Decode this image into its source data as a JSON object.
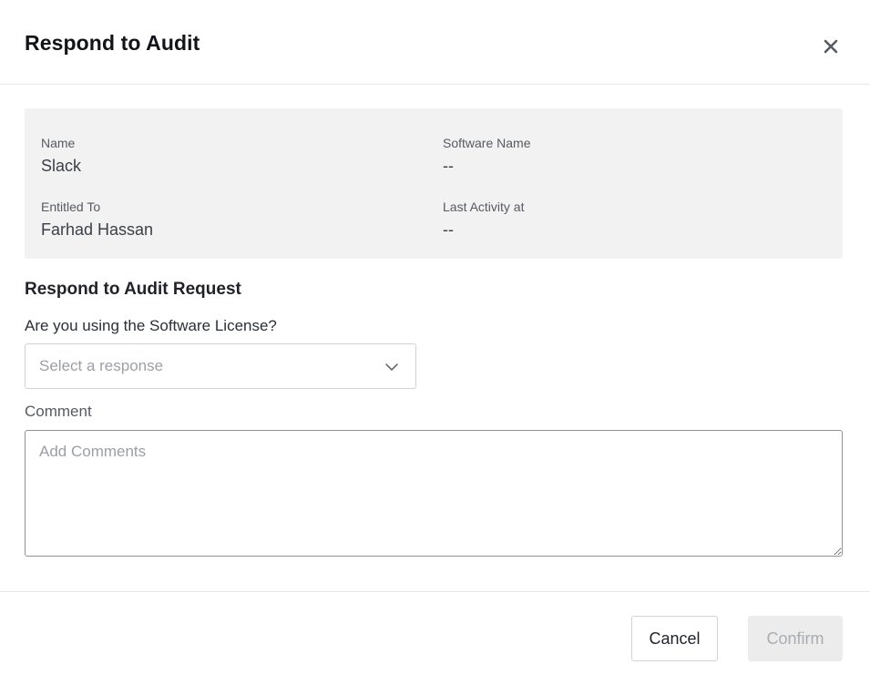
{
  "dialog": {
    "title": "Respond to Audit",
    "close_icon": "close-icon"
  },
  "details": {
    "name_label": "Name",
    "name_value": "Slack",
    "software_label": "Software Name",
    "software_value": "--",
    "entitled_label": "Entitled To",
    "entitled_value": "Farhad Hassan",
    "activity_label": "Last Activity at",
    "activity_value": "--"
  },
  "form": {
    "section_title": "Respond to Audit Request",
    "question": "Are you using the Software License?",
    "select_placeholder": "Select a response",
    "select_icon": "chevron-down-icon",
    "comment_label": "Comment",
    "comment_placeholder": "Add Comments",
    "comment_value": ""
  },
  "footer": {
    "cancel_label": "Cancel",
    "confirm_label": "Confirm"
  },
  "colors": {
    "panel_background": "#f2f2f2",
    "disabled_button": "#ececec",
    "disabled_text": "#a9adb2"
  }
}
